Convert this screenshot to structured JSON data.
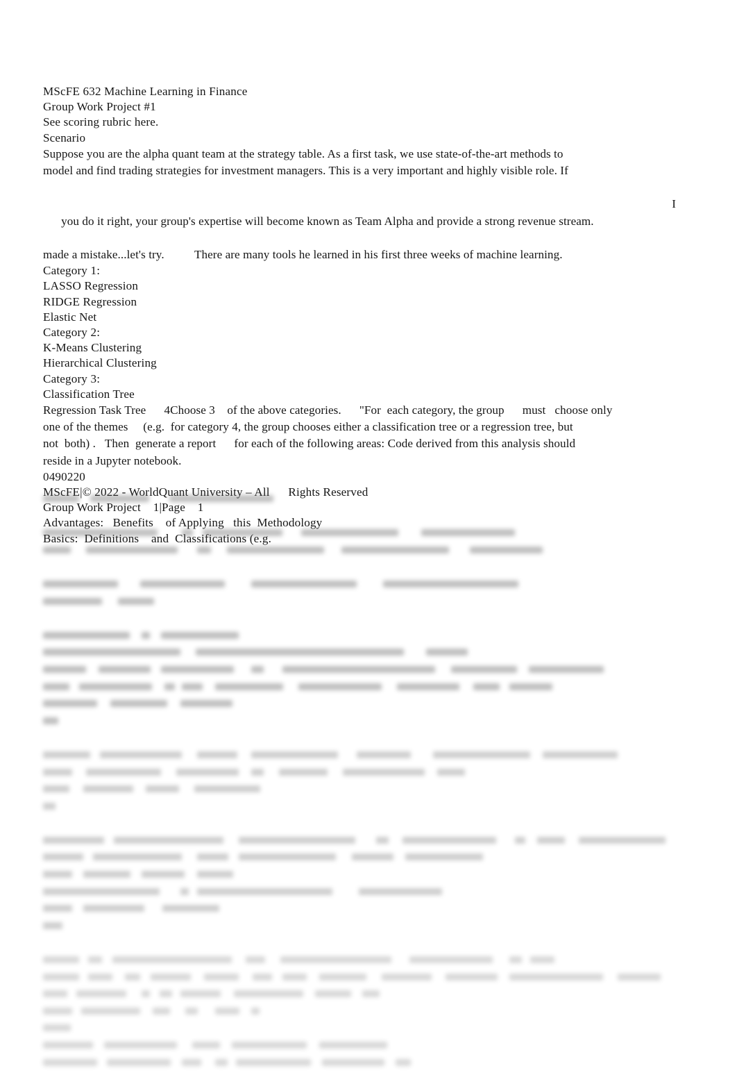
{
  "document": {
    "page_background": "#ffffff",
    "text_color": "#161616",
    "header_lines": [
      "MScFE 632 Machine Learning in Finance",
      "Group Work Project #1",
      "See scoring rubric here.",
      "Scenario"
    ],
    "scenario_paragraph": {
      "line_1": "Suppose you are the alpha quant team at the strategy table. As a first task, we use state-of-the-art methods to",
      "line_2": "model and find trading strategies for investment managers. This is a very important and highly visible role. If",
      "line_3": "you do it right, your group's expertise will become known as Team Alpha and provide a strong revenue stream.",
      "line_3_trailing": "I",
      "line_4": "made a mistake...let's try.          There are many tools he learned in his first three weeks of machine learning."
    },
    "categories": [
      "Category 1:",
      "LASSO Regression",
      "RIDGE Regression",
      "Elastic Net",
      "Category 2:",
      "K-Means Clustering",
      "Hierarchical Clustering",
      "Category 3:",
      "Classification Tree"
    ],
    "instructions_paragraph": {
      "line_1": "Regression Task Tree      4Choose 3    of the above categories.      \"For  each category, the group      must   choose only",
      "line_2": "one of the themes     (e.g.  for category 4, the group chooses either a classification tree or a regression tree, but",
      "line_3": "not  both) .   Then  generate a report      for each of the following areas: Code derived from this analysis should",
      "line_4": "reside in a Jupyter notebook."
    },
    "footer_lines": [
      "0490220",
      "MScFE|© 2022 - WorldQuant University – All      Rights Reserved",
      "Group Work Project    1|Page    1",
      "Advantages:   Benefits    of Applying   this  Methodology",
      "Basics:  Definitions    and  Classifications (e.g."
    ],
    "blurred_region": {
      "note": "Lower portion of the page is blurred and illegible.",
      "lines": [
        [
          [
            0,
            52
          ],
          [
            68,
            85
          ],
          [
            182,
            150
          ]
        ],
        [],
        [
          [
            0,
            165
          ],
          [
            200,
            16
          ],
          [
            230,
            115
          ],
          [
            372,
            140
          ],
          [
            545,
            135
          ]
        ],
        [
          [
            0,
            40
          ],
          [
            62,
            132
          ],
          [
            222,
            20
          ],
          [
            265,
            140
          ],
          [
            430,
            155
          ],
          [
            615,
            105
          ]
        ],
        [],
        [
          [
            0,
            108
          ],
          [
            140,
            122
          ],
          [
            300,
            152
          ],
          [
            490,
            195
          ]
        ],
        [
          [
            0,
            85
          ],
          [
            108,
            52
          ]
        ],
        [],
        [
          [
            0,
            125
          ],
          [
            142,
            12
          ],
          [
            170,
            112
          ]
        ],
        [
          [
            0,
            198
          ],
          [
            220,
            300
          ],
          [
            552,
            60
          ]
        ],
        [
          [
            0,
            62
          ],
          [
            80,
            75
          ],
          [
            170,
            105
          ],
          [
            300,
            18
          ],
          [
            345,
            220
          ],
          [
            588,
            95
          ],
          [
            700,
            108
          ]
        ],
        [
          [
            0,
            38
          ],
          [
            52,
            105
          ],
          [
            175,
            15
          ],
          [
            200,
            30
          ],
          [
            248,
            98
          ],
          [
            368,
            120
          ],
          [
            510,
            90
          ],
          [
            620,
            38
          ],
          [
            672,
            62
          ]
        ],
        [
          [
            0,
            78
          ],
          [
            97,
            82
          ],
          [
            198,
            75
          ]
        ],
        [
          [
            0,
            22
          ]
        ],
        [],
        [
          [
            0,
            68
          ],
          [
            82,
            118
          ],
          [
            222,
            58
          ],
          [
            300,
            125
          ],
          [
            452,
            78
          ],
          [
            562,
            140
          ],
          [
            720,
            108
          ]
        ],
        [
          [
            0,
            42
          ],
          [
            62,
            108
          ],
          [
            192,
            90
          ],
          [
            300,
            18
          ],
          [
            340,
            70
          ],
          [
            432,
            118
          ],
          [
            568,
            40
          ]
        ],
        [
          [
            0,
            38
          ],
          [
            58,
            72
          ],
          [
            148,
            48
          ],
          [
            218,
            95
          ]
        ],
        [
          [
            0,
            18
          ]
        ],
        [],
        [
          [
            0,
            88
          ],
          [
            102,
            158
          ],
          [
            282,
            168
          ],
          [
            480,
            18
          ],
          [
            518,
            135
          ],
          [
            680,
            15
          ],
          [
            712,
            40
          ],
          [
            772,
            125
          ]
        ],
        [
          [
            0,
            58
          ],
          [
            72,
            128
          ],
          [
            222,
            45
          ],
          [
            282,
            140
          ],
          [
            445,
            60
          ],
          [
            522,
            112
          ]
        ],
        [
          [
            0,
            42
          ],
          [
            58,
            68
          ],
          [
            142,
            62
          ],
          [
            222,
            52
          ]
        ],
        [
          [
            0,
            168
          ],
          [
            198,
            12
          ],
          [
            222,
            195
          ],
          [
            455,
            120
          ]
        ],
        [
          [
            0,
            42
          ],
          [
            58,
            88
          ],
          [
            172,
            82
          ]
        ],
        [
          [
            0,
            28
          ]
        ],
        [],
        [
          [
            0,
            52
          ],
          [
            65,
            20
          ],
          [
            100,
            172
          ],
          [
            292,
            28
          ],
          [
            342,
            160
          ],
          [
            528,
            120
          ],
          [
            672,
            18
          ],
          [
            702,
            35
          ]
        ],
        [
          [
            0,
            52
          ],
          [
            65,
            35
          ],
          [
            118,
            22
          ],
          [
            155,
            58
          ],
          [
            232,
            50
          ],
          [
            302,
            28
          ],
          [
            345,
            35
          ],
          [
            398,
            68
          ],
          [
            488,
            72
          ],
          [
            580,
            75
          ],
          [
            672,
            135
          ],
          [
            828,
            62
          ]
        ],
        [
          [
            0,
            35
          ],
          [
            48,
            72
          ],
          [
            142,
            12
          ],
          [
            168,
            18
          ],
          [
            198,
            58
          ],
          [
            275,
            100
          ],
          [
            392,
            52
          ],
          [
            460,
            25
          ]
        ],
        [
          [
            0,
            42
          ],
          [
            55,
            85
          ],
          [
            158,
            25
          ],
          [
            205,
            18
          ],
          [
            248,
            35
          ],
          [
            300,
            12
          ]
        ],
        [
          [
            0,
            40
          ]
        ],
        [
          [
            0,
            72
          ],
          [
            88,
            105
          ],
          [
            215,
            40
          ],
          [
            272,
            108
          ],
          [
            398,
            98
          ]
        ],
        [
          [
            0,
            78
          ],
          [
            92,
            92
          ],
          [
            200,
            28
          ],
          [
            248,
            18
          ],
          [
            278,
            108
          ],
          [
            402,
            90
          ],
          [
            508,
            22
          ]
        ]
      ]
    }
  }
}
